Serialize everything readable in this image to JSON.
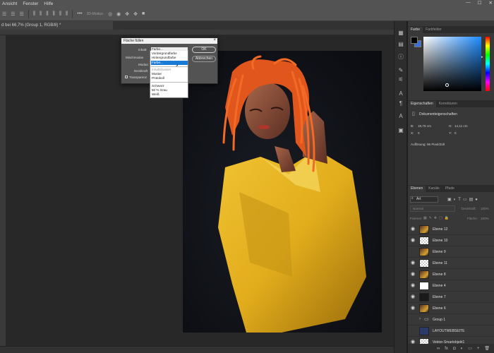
{
  "menu": [
    "Ansicht",
    "Fenster",
    "Hilfe"
  ],
  "window_controls": [
    "—",
    "☐",
    "✕"
  ],
  "optbar": {
    "mode_label": "3D-Modus:"
  },
  "doc_tab": "d bei 66,7% (Group 1, RGB/8) *",
  "dialog": {
    "title": "Fläche füllen",
    "inhalt_label": "Inhalt:",
    "inhalt_value": "Farbe...",
    "mischmodus_label": "Mischmodus",
    "modus_label": "Modus:",
    "deckkraft_label": "Deckkraft",
    "transparenz_label": "Transparenz",
    "ok_label": "OK",
    "cancel_label": "Abbrechen"
  },
  "dropdown": {
    "items": [
      "Vordergrundfarbe",
      "Hintergrundfarbe",
      "Farbe...",
      "Inhaltsbasiert",
      "Muster",
      "Protokoll",
      "Schwarz",
      "50 % Grau",
      "Weiß"
    ],
    "selected_index": 2,
    "disabled_index": 3
  },
  "color_panel": {
    "tabs": [
      "Farbe",
      "Farbfelder"
    ],
    "foreground_color": "#000000",
    "background_color": "#3c6fd1"
  },
  "props_panel": {
    "tabs": [
      "Eigenschaften",
      "Korrekturen"
    ],
    "doc_label": "Dokumenteigenschaften",
    "b_label": "B:",
    "b_value": "19,76 cm",
    "h_label": "H:",
    "h_value": "14,11 cm",
    "x_label": "X:",
    "x_value": "0",
    "y_label": "Y:",
    "y_value": "0",
    "resolution": "Auflösung: 96 Pixel/Zoll"
  },
  "layers_panel": {
    "tabs": [
      "Ebenen",
      "Kanäle",
      "Pfade"
    ],
    "filter_label": "Art",
    "blend_mode": "Normal",
    "opacity_label": "Deckkraft:",
    "opacity_value": "100%",
    "lock_label": "Fixieren:",
    "fill_label": "Fläche:",
    "fill_value": "100%",
    "layers": [
      {
        "name": "Ebene 12",
        "thumb": "photo",
        "visible": true
      },
      {
        "name": "Ebene 10",
        "thumb": "checker",
        "visible": true
      },
      {
        "name": "Ebene 9",
        "thumb": "photo",
        "visible": false
      },
      {
        "name": "Ebene 11",
        "thumb": "checker",
        "visible": true
      },
      {
        "name": "Ebene 8",
        "thumb": "photo",
        "visible": true
      },
      {
        "name": "Ebene 4",
        "thumb": "white",
        "visible": true
      },
      {
        "name": "Ebene 7",
        "thumb": "dark",
        "visible": true
      },
      {
        "name": "Ebene 6",
        "thumb": "photo",
        "visible": true
      },
      {
        "name": "Group 1",
        "thumb": "folder",
        "visible": false
      },
      {
        "name": "LAYOUTWEBSEITE",
        "thumb": "smart",
        "visible": false
      },
      {
        "name": "Vektor-Smartobjekt1",
        "thumb": "checker",
        "visible": true
      }
    ]
  },
  "layers_footer_icons": [
    "link-icon",
    "fx-icon",
    "mask-icon",
    "adjustment-icon",
    "folder-icon",
    "new-layer-icon",
    "trash-icon"
  ]
}
